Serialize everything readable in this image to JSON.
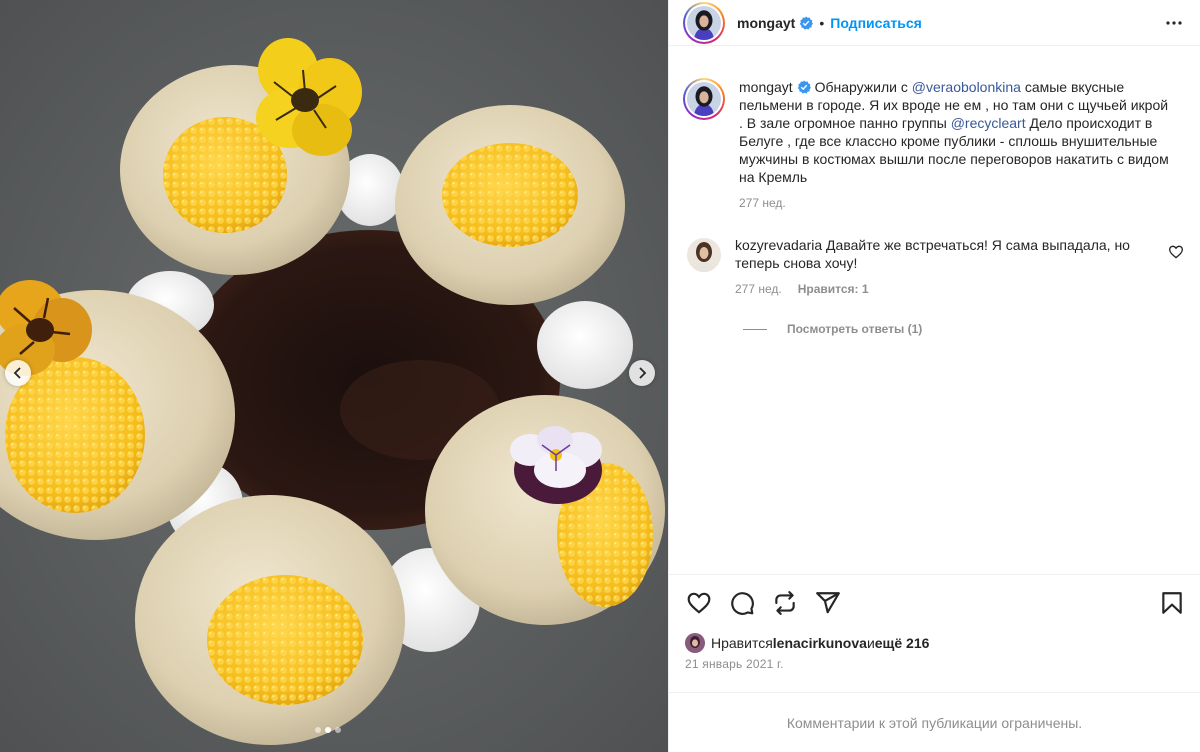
{
  "post": {
    "author": {
      "username": "mongayt",
      "verified": true,
      "follow_label": "Подписаться",
      "separator": "•"
    },
    "caption": {
      "username": "mongayt",
      "before_mention1": " Обнаружили с ",
      "mention1": "@veraobolonkina",
      "middle": " самые вкусные пельмени в городе. Я их вроде не ем , но там они с щучьей икрой . В зале огромное панно группы ",
      "mention2": "@recycleart",
      "after": " Дело происходит в Белуге , где все классно кроме публики - сплошь внушительные мужчины в костюмах вышли после переговоров накатить с видом на Кремль",
      "time": "277 нед."
    },
    "comments": [
      {
        "username": "kozyrevadaria",
        "text": " Давайте же встречаться! Я сама выпадала, но теперь снова хочу!",
        "time": "277 нед.",
        "likes": "Нравится: 1",
        "view_replies": "Посмотреть ответы (1)"
      }
    ],
    "liked_by": {
      "prefix": "Нравится ",
      "user": "lenacirkunova",
      "conj": " и ",
      "others": "ещё 216"
    },
    "date": "21 январь 2021 г.",
    "comments_limited": "Комментарии к этой публикации ограничены.",
    "carousel": {
      "total": 3,
      "active": 1
    }
  },
  "colors": {
    "link": "#385898",
    "follow": "#0095f6",
    "muted": "#8e8e8e",
    "verified": "#3897f0"
  },
  "icons": {
    "more": "more-horizontal-icon",
    "like": "heart-icon",
    "comment": "comment-bubble-icon",
    "repost": "repost-icon",
    "share": "send-icon",
    "save": "bookmark-icon",
    "prev": "chevron-left-icon",
    "next": "chevron-right-icon"
  }
}
